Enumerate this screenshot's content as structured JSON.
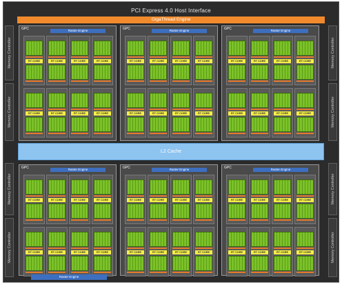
{
  "header": {
    "pcie": "PCI Express 4.0 Host Interface",
    "giga": "GigaThread Engine"
  },
  "memory_controller_label": "Memory Controller",
  "gpc_label": "GPC",
  "raster_label": "Raster Engine",
  "rt_core_label": "RT CORE",
  "l2_label": "L2 Cache",
  "bottom_label": "Raster Engine",
  "colors": {
    "background": "#2b2b2b",
    "giga": "#f08a2c",
    "sm": "#7cc228",
    "rt": "#f3ee46",
    "l2": "#8ec4f0",
    "raster": "#3d6fc0"
  }
}
